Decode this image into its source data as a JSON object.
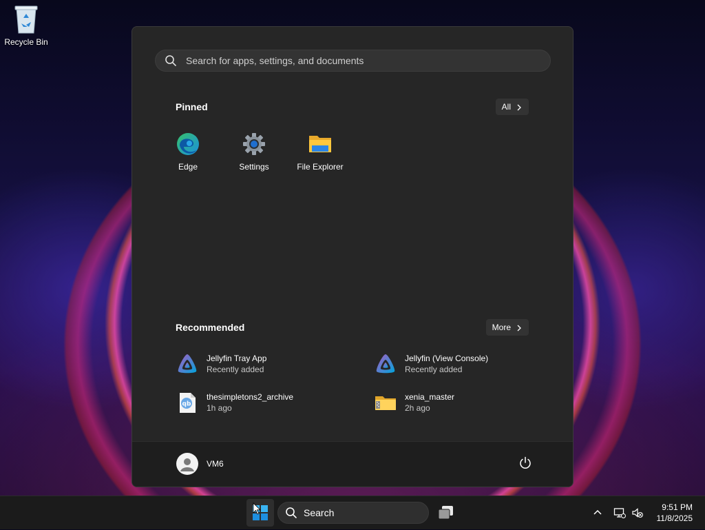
{
  "desktop": {
    "icons": [
      {
        "label": "Recycle Bin",
        "icon": "recycle-bin-icon"
      }
    ]
  },
  "start_menu": {
    "search": {
      "placeholder": "Search for apps, settings, and documents"
    },
    "pinned": {
      "title": "Pinned",
      "all_button": "All",
      "apps": [
        {
          "name": "Edge",
          "icon": "edge-icon"
        },
        {
          "name": "Settings",
          "icon": "settings-gear-icon"
        },
        {
          "name": "File Explorer",
          "icon": "file-explorer-icon"
        }
      ]
    },
    "recommended": {
      "title": "Recommended",
      "more_button": "More",
      "items": [
        {
          "name": "Jellyfin Tray App",
          "sub": "Recently added",
          "icon": "jellyfin-icon"
        },
        {
          "name": "Jellyfin (View Console)",
          "sub": "Recently added",
          "icon": "jellyfin-icon"
        },
        {
          "name": "thesimpletons2_archive",
          "sub": "1h ago",
          "icon": "qbittorrent-file-icon"
        },
        {
          "name": "xenia_master",
          "sub": "2h ago",
          "icon": "zip-folder-icon"
        }
      ]
    },
    "user": {
      "name": "VM6"
    }
  },
  "taskbar": {
    "search_label": "Search",
    "clock": {
      "time": "9:51 PM",
      "date": "11/8/2025"
    }
  },
  "colors": {
    "accent": "#0078d4",
    "jellyfin_purple": "#aa5cc3",
    "jellyfin_blue": "#00a4dc"
  }
}
